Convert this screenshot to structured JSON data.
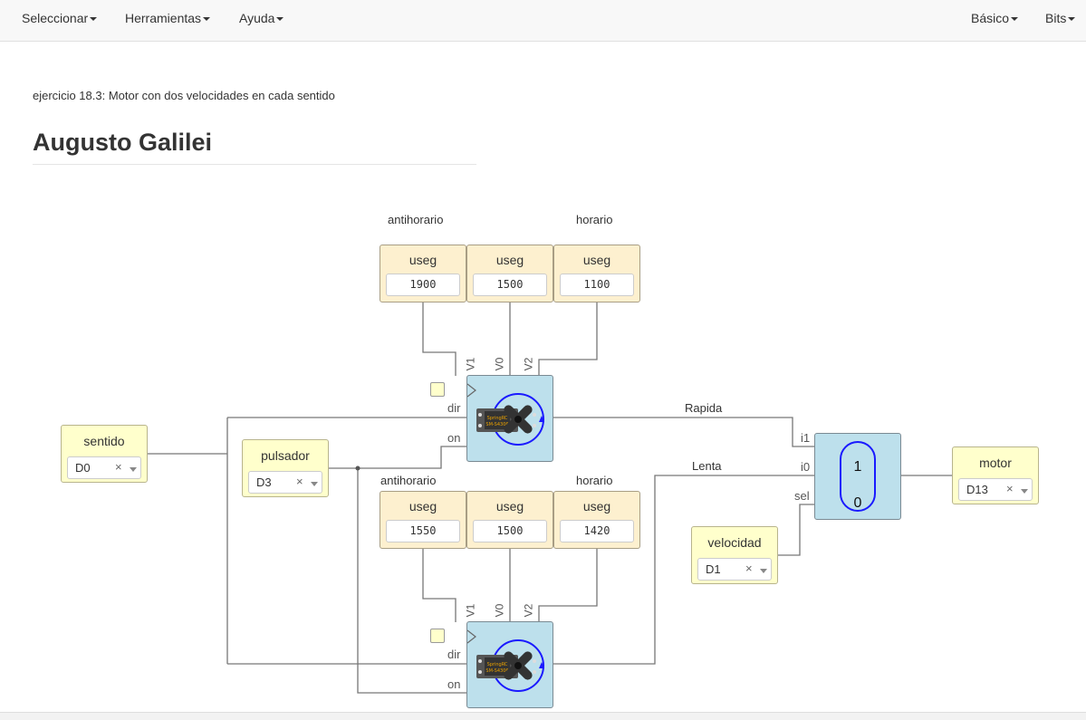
{
  "menu": {
    "left": [
      "Seleccionar",
      "Herramientas",
      "Ayuda"
    ],
    "right": [
      "Básico",
      "Bits"
    ]
  },
  "page": {
    "subtitle": "ejercicio 18.3: Motor con dos velocidades en cada sentido",
    "title": "Augusto Galilei"
  },
  "circuit": {
    "top_group": {
      "label_left": "antihorario",
      "label_right": "horario",
      "constants": [
        {
          "title": "useg",
          "value": "1900"
        },
        {
          "title": "useg",
          "value": "1500"
        },
        {
          "title": "useg",
          "value": "1100"
        }
      ]
    },
    "bottom_group": {
      "label_left": "antihorario",
      "label_right": "horario",
      "constants": [
        {
          "title": "useg",
          "value": "1550"
        },
        {
          "title": "useg",
          "value": "1500"
        },
        {
          "title": "useg",
          "value": "1420"
        }
      ]
    },
    "servo_ports": {
      "v1": "V1",
      "v0": "V0",
      "v2": "V2",
      "dir": "dir",
      "on": "on"
    },
    "inputs": {
      "sentido": {
        "title": "sentido",
        "value": "D0"
      },
      "pulsador": {
        "title": "pulsador",
        "value": "D3"
      },
      "velocidad": {
        "title": "velocidad",
        "value": "D1"
      }
    },
    "output": {
      "motor": {
        "title": "motor",
        "value": "D13"
      }
    },
    "wire_labels": {
      "rapida": "Rapida",
      "lenta": "Lenta"
    },
    "mux": {
      "i1": "i1",
      "i0": "i0",
      "sel": "sel",
      "top": "1",
      "bottom": "0"
    },
    "clear_symbol": "×"
  },
  "colors": {
    "constant_block": "#fdf0cf",
    "io_block": "#ffffcc",
    "module_block": "#bde0ec",
    "wire": "#777777",
    "accent_blue": "#1a1aff"
  }
}
